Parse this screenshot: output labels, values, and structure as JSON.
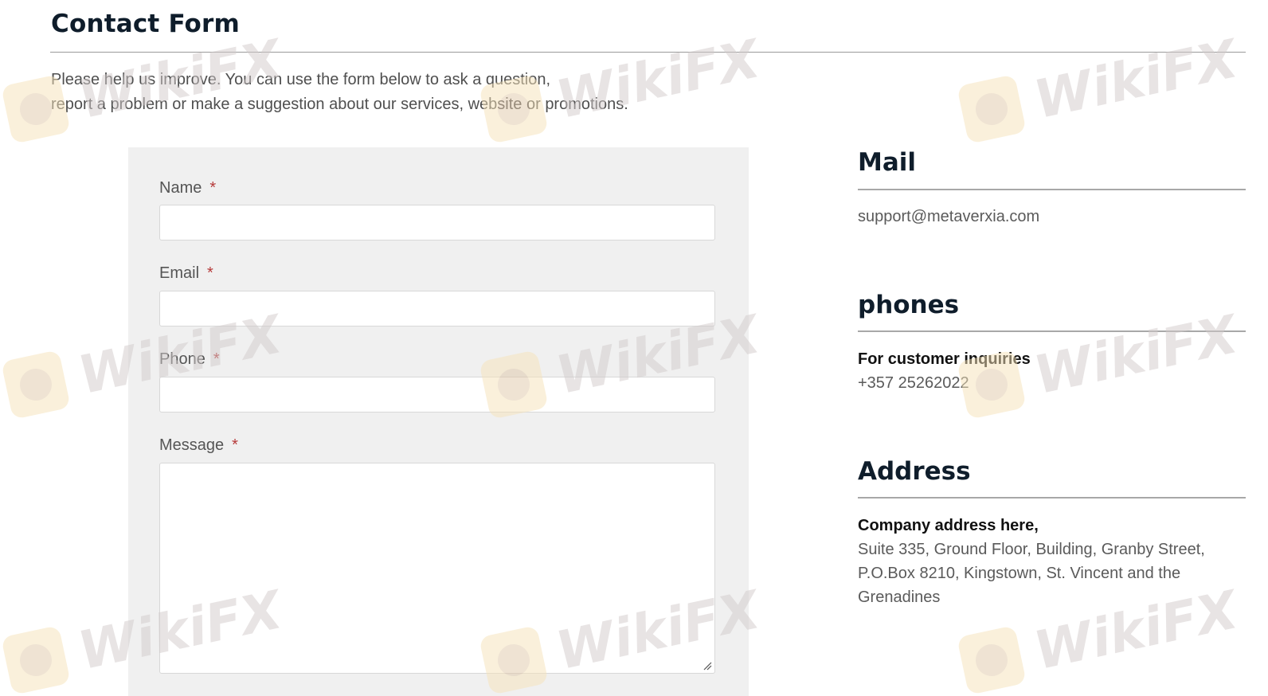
{
  "page": {
    "title": "Contact Form",
    "intro_line1": "Please help us improve. You can use the form below to ask a question,",
    "intro_line2": "report a problem or make a suggestion about our services, website or promotions."
  },
  "form": {
    "required_mark": "*",
    "name_label": "Name",
    "email_label": "Email",
    "phone_label": "Phone",
    "message_label": "Message",
    "name_value": "",
    "email_value": "",
    "phone_value": "",
    "message_value": ""
  },
  "mail": {
    "heading": "Mail",
    "email": "support@metaverxia.com"
  },
  "phones": {
    "heading": "phones",
    "label": "For customer inquiries",
    "number": "+357 25262022"
  },
  "address": {
    "heading": "Address",
    "label": "Company address here,",
    "line1": "Suite 335, Ground Floor, Building, Granby Street,",
    "line2": "P.O.Box 8210, Kingstown, St. Vincent and the",
    "line3": "Grenadines"
  },
  "watermark": {
    "text": "WikiFX"
  },
  "colors": {
    "heading": "#0f1d2b",
    "required": "#b63a3a",
    "panel": "#f0f0f0"
  }
}
